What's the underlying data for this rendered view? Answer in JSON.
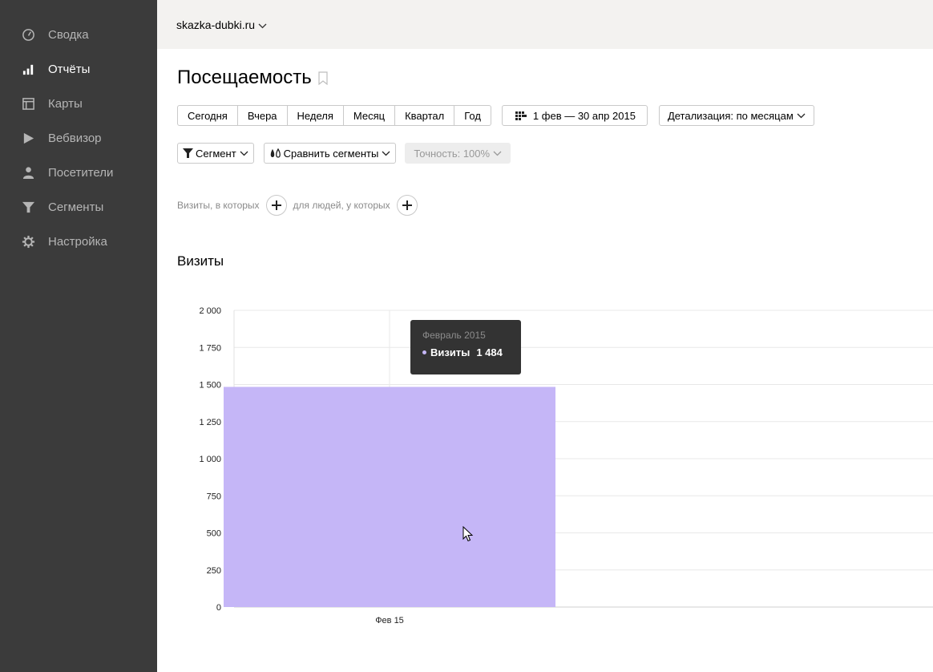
{
  "sidebar": {
    "items": [
      {
        "label": "Сводка",
        "icon": "gauge-icon",
        "active": false
      },
      {
        "label": "Отчёты",
        "icon": "bar-chart-icon",
        "active": true
      },
      {
        "label": "Карты",
        "icon": "map-icon",
        "active": false
      },
      {
        "label": "Вебвизор",
        "icon": "play-icon",
        "active": false
      },
      {
        "label": "Посетители",
        "icon": "person-icon",
        "active": false
      },
      {
        "label": "Сегменты",
        "icon": "funnel-icon",
        "active": false
      },
      {
        "label": "Настройка",
        "icon": "gear-icon",
        "active": false
      }
    ]
  },
  "topbar": {
    "site": "skazka-dubki.ru"
  },
  "page": {
    "title": "Посещаемость"
  },
  "periods": [
    "Сегодня",
    "Вчера",
    "Неделя",
    "Месяц",
    "Квартал",
    "Год"
  ],
  "date_range": "1 фев — 30 апр 2015",
  "detail": "Детализация: по месяцам",
  "segment_label": "Сегмент",
  "compare_label": "Сравнить сегменты",
  "accuracy_label": "Точность: 100%",
  "filter": {
    "visits_where": "Визиты, в которых",
    "for_people": "для людей, у которых"
  },
  "chart_heading": "Визиты",
  "colors": {
    "bar": "#c5b6f7",
    "sidebar_bg": "#3b3b3b",
    "tooltip_bg": "#333333"
  },
  "chart_data": {
    "type": "bar",
    "categories": [
      "Фев 15"
    ],
    "series": [
      {
        "name": "Визиты",
        "values": [
          1484
        ]
      }
    ],
    "ylim": [
      0,
      2000
    ],
    "yticks": [
      0,
      250,
      500,
      750,
      1000,
      1250,
      1500,
      1750,
      2000
    ],
    "ytick_labels": [
      "0",
      "250",
      "500",
      "750",
      "1 000",
      "1 250",
      "1 500",
      "1 750",
      "2 000"
    ],
    "grid": true,
    "tooltip": {
      "header": "Февраль 2015",
      "series": "Визиты",
      "value": "1 484"
    }
  }
}
